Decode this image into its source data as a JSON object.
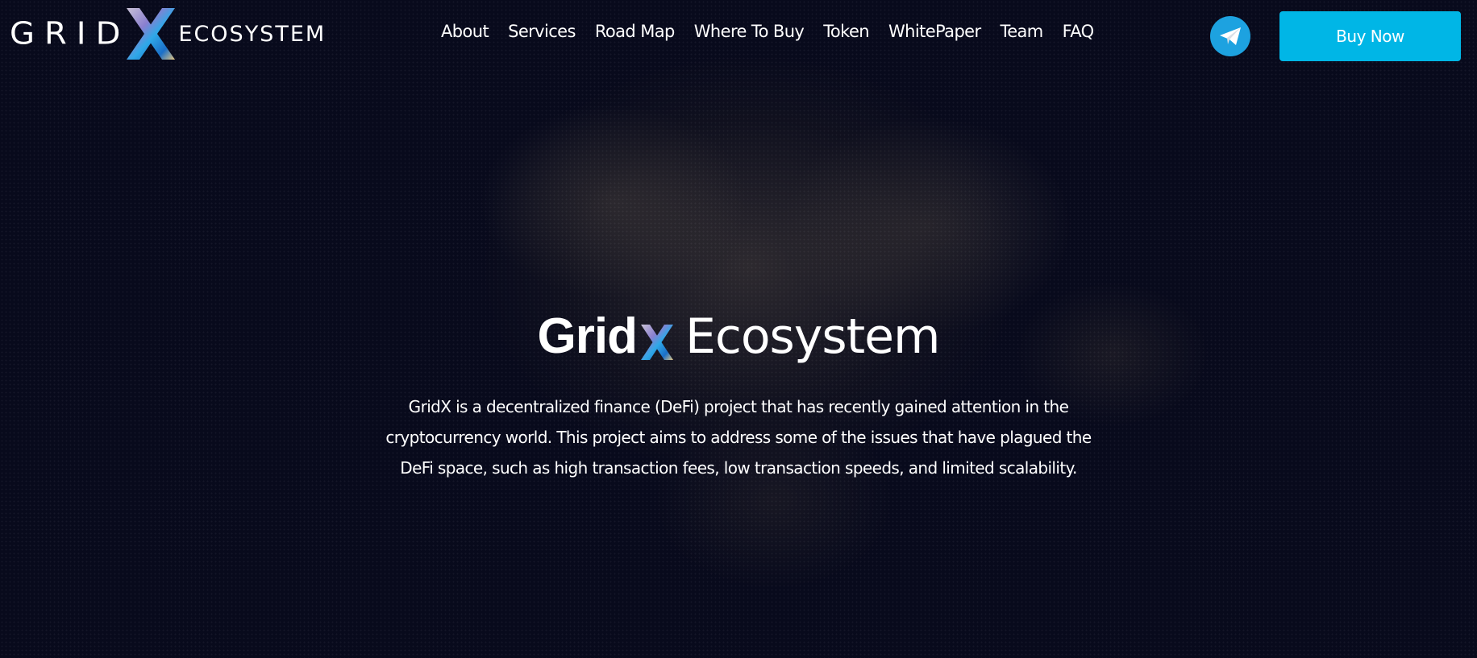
{
  "header": {
    "logo": {
      "grid_text": "GRID",
      "ecosystem_text": "ECOSYSTEM"
    },
    "nav": [
      {
        "label": "About"
      },
      {
        "label": "Services"
      },
      {
        "label": "Road Map"
      },
      {
        "label": "Where To Buy"
      },
      {
        "label": "Token"
      },
      {
        "label": "WhitePaper"
      },
      {
        "label": "Team"
      },
      {
        "label": "FAQ"
      }
    ],
    "telegram_icon": "telegram-icon",
    "buy_button": "Buy Now"
  },
  "hero": {
    "title_bold": "Grid",
    "title_light": "Ecosystem",
    "description": "GridX is a decentralized finance (DeFi) project that has recently gained attention in the cryptocurrency world. This project aims to address some of the issues that have plagued the DeFi space, such as high transaction fees, low transaction speeds, and limited scalability."
  },
  "colors": {
    "background": "#080a1c",
    "accent": "#00b6e6",
    "telegram": "#1da2e0"
  }
}
